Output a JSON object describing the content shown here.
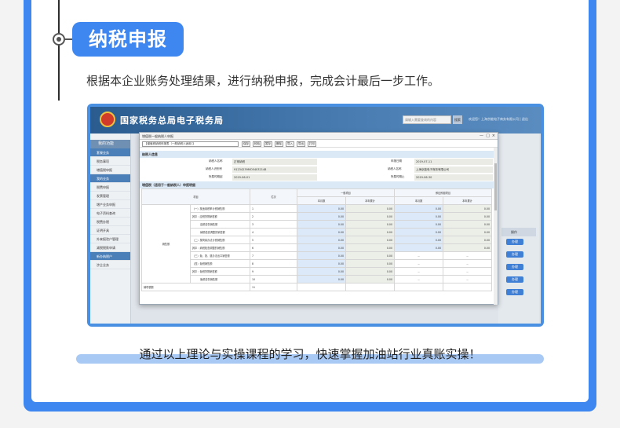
{
  "section": {
    "title": "纳税申报",
    "intro": "根据本企业账务处理结果，进行纳税申报，完成会计最后一步工作。",
    "footer": "通过以上理论与实操课程的学习，快速掌握加油站行业真账实操！"
  },
  "portal": {
    "site_title": "国家税务总局电子税务局",
    "search_placeholder": "请输入需要查询的内容",
    "search_button": "搜索",
    "user_text": "欢迎您！上海京能电子商务有限公司 | 退出",
    "sidebar": {
      "header": "我的功能",
      "groups": [
        {
          "label": "套餐业务",
          "items": [
            "税务事项",
            "增值税申报"
          ]
        },
        {
          "label": "我的业务",
          "items": [
            "税费申报",
            "发票管理",
            "增产业务申报",
            "电子资料查询",
            "税费办税",
            "证明开具",
            "外来报验户管理",
            "减税税款申请"
          ]
        },
        {
          "label": "新办纳税户",
          "items": [
            "涉企业务"
          ]
        }
      ]
    },
    "right_header": "操作",
    "right_buttons": [
      "办理",
      "办理",
      "办理",
      "办理",
      "办理"
    ],
    "colors": {
      "accent": "#3f87f0",
      "portal_header": "#2b5c8f"
    }
  },
  "dialog": {
    "title": "增值税一般纳税人申报",
    "controls": [
      "—",
      "□",
      "×"
    ],
    "form_select": "【增值税纳税申报表（一般纳税人适用）】",
    "toolbar": [
      "保存",
      "校验",
      "暂存",
      "删除",
      "导入",
      "导出",
      "打印"
    ],
    "basic_section": "纳税人信息",
    "basic_rows": [
      {
        "l1": "纳税人名称",
        "v1": "正常纳税",
        "l2": "申报日期",
        "v2": "2019-07-11"
      },
      {
        "l1": "纳税人识别号",
        "v1": "91234239MO54032148",
        "l2": "纳税人名称",
        "v2": "上海京能电子商务有限公司"
      },
      {
        "l1": "所属时期起",
        "v1": "2019-06-01",
        "l2": "所属时期止",
        "v2": "2019-06-30"
      }
    ],
    "table_section": "增值税（适用于一般纳税人）申报明细",
    "headers": {
      "item": "项目",
      "col": "栏次",
      "general": "一般项目",
      "refund": "即征即退项目",
      "this_month": "本月数",
      "ytd": "本年累计"
    },
    "row_group": "销售额",
    "rows": [
      {
        "item": "（一）按适用税率计税销售额",
        "col": "1",
        "v": [
          "0.00",
          "0.00",
          "0.00",
          "0.00"
        ]
      },
      {
        "item": "其中：应税货物销售额",
        "col": "2",
        "v": [
          "0.00",
          "0.00",
          "0.00",
          "0.00"
        ]
      },
      {
        "item": "应税劳务销售额",
        "col": "3",
        "v": [
          "0.00",
          "0.00",
          "0.00",
          "0.00"
        ]
      },
      {
        "item": "纳税检查调整的销售额",
        "col": "4",
        "v": [
          "0.00",
          "0.00",
          "0.00",
          "0.00"
        ]
      },
      {
        "item": "（二）按简易办法计税销售额",
        "col": "5",
        "v": [
          "0.00",
          "0.00",
          "0.00",
          "0.00"
        ]
      },
      {
        "item": "其中：纳税检查调整的销售额",
        "col": "6",
        "v": [
          "0.00",
          "0.00",
          "0.00",
          "0.00"
        ]
      },
      {
        "item": "（三）免、抵、退办法出口销售额",
        "col": "7",
        "v": [
          "0.00",
          "0.00",
          "--",
          "--"
        ]
      },
      {
        "item": "（四）免税销售额",
        "col": "8",
        "v": [
          "0.00",
          "0.00",
          "--",
          "--"
        ]
      },
      {
        "item": "其中：免税货物销售额",
        "col": "9",
        "v": [
          "0.00",
          "0.00",
          "--",
          "--"
        ]
      },
      {
        "item": "免税劳务销售额",
        "col": "10",
        "v": [
          "0.00",
          "0.00",
          "--",
          "--"
        ]
      }
    ],
    "last_row": {
      "item": "销项税额",
      "col": "11"
    }
  }
}
